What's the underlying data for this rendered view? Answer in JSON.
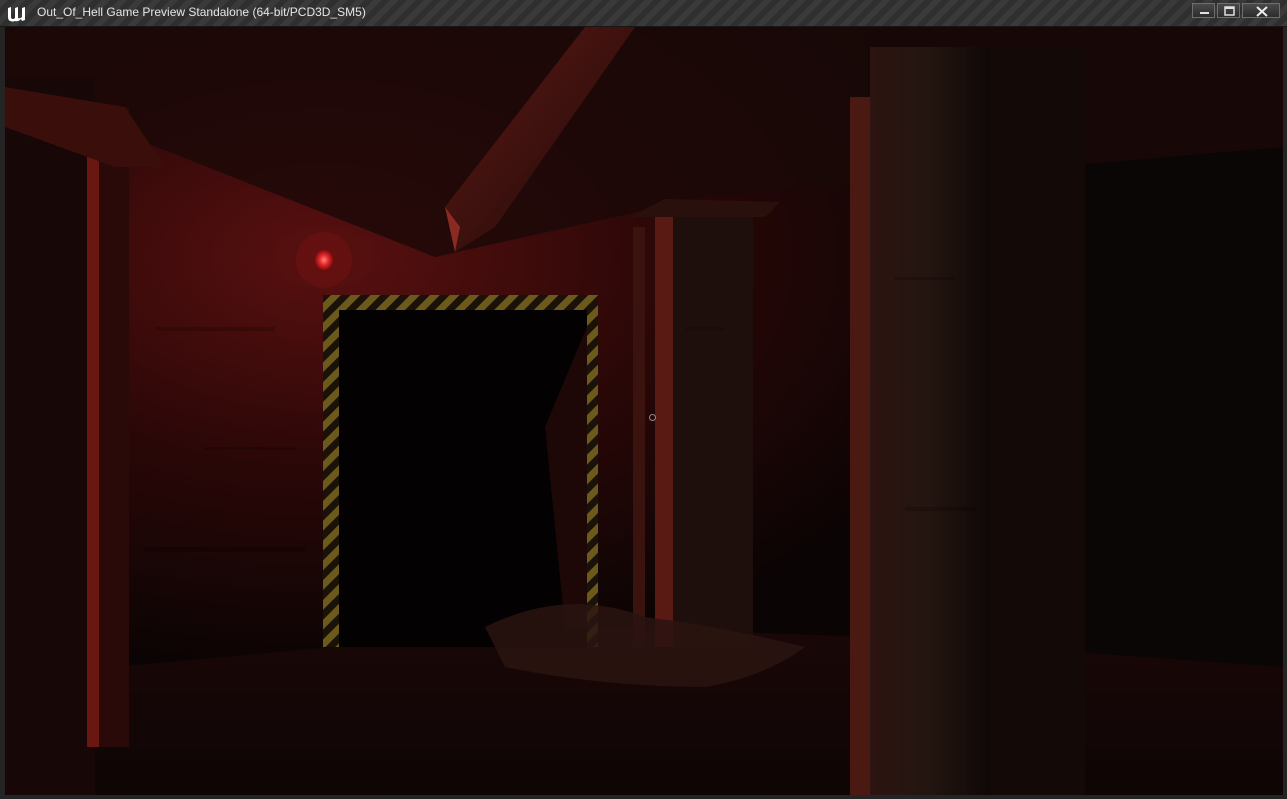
{
  "window": {
    "title": "Out_Of_Hell Game Preview Standalone (64-bit/PCD3D_SM5)",
    "icon": "unreal-engine-logo-icon",
    "controls": [
      "minimize-icon",
      "maximize-icon",
      "close-icon"
    ]
  },
  "scene": {
    "description_icon": "game-viewport",
    "crosshair_icon": "crosshair-icon",
    "palette": {
      "ambient": "#070303",
      "red_light": "#8a1010",
      "warning_light": "#ff6a6a",
      "hazard_yellow": "#6b5a1c",
      "hazard_dark": "#1a1208"
    }
  }
}
